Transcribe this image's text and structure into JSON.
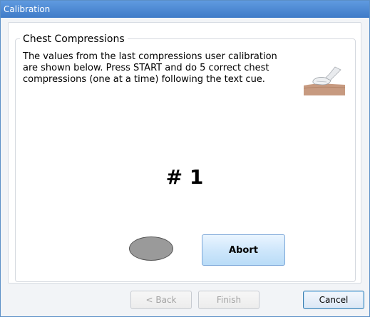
{
  "window": {
    "title": "Calibration"
  },
  "group": {
    "title": "Chest Compressions"
  },
  "instructions": "The values from the last compressions user calibration are shown below.  Press START and do 5 correct chest compressions (one at a time) following the text cue.",
  "illustration": {
    "icon": "gloved-hands-chest-compression-icon"
  },
  "counter": "# 1",
  "indicator": {
    "color": "#9a9a9a"
  },
  "buttons": {
    "abort": "Abort",
    "back": "< Back",
    "finish": "Finish",
    "cancel": "Cancel"
  },
  "colors": {
    "titlebar": "#4a88d4",
    "accent_button": "#cfe7fb"
  }
}
